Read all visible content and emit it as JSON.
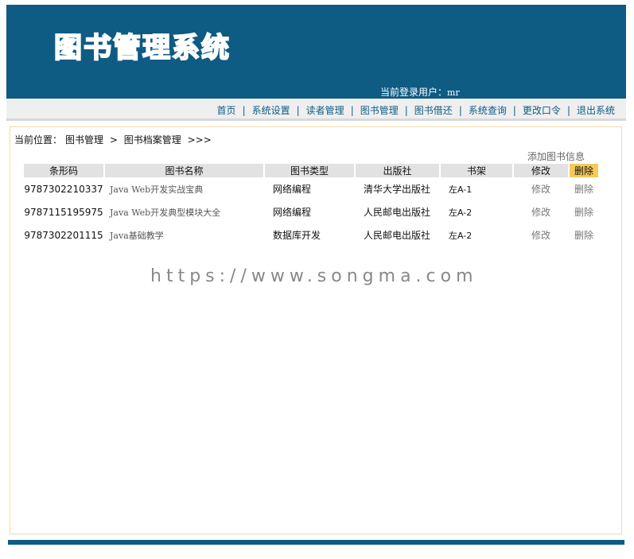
{
  "header": {
    "logo_text": "图书管理系统",
    "login_label": "当前登录用户：",
    "login_user": "mr"
  },
  "nav": {
    "items": [
      "首页",
      "系统设置",
      "读者管理",
      "图书管理",
      "图书借还",
      "系统查询",
      "更改口令",
      "退出系统"
    ],
    "separator": "|"
  },
  "breadcrumb": {
    "label": "当前位置：",
    "section": "图书管理",
    "arrow": ">",
    "page": "图书档案管理",
    "trail": ">>>"
  },
  "actions": {
    "add_book": "添加图书信息"
  },
  "table": {
    "columns": [
      "条形码",
      "图书名称",
      "图书类型",
      "出版社",
      "书架",
      "修改",
      "删除"
    ],
    "rows": [
      {
        "barcode": "9787302210337",
        "name": "Java Web开发实战宝典",
        "type": "网络编程",
        "publisher": "清华大学出版社",
        "shelf": "左A-1",
        "edit": "修改",
        "delete": "删除"
      },
      {
        "barcode": "9787115195975",
        "name": "Java Web开发典型模块大全",
        "type": "网络编程",
        "publisher": "人民邮电出版社",
        "shelf": "左A-2",
        "edit": "修改",
        "delete": "删除"
      },
      {
        "barcode": "9787302201115",
        "name": "Java基础教学",
        "type": "数据库开发",
        "publisher": "人民邮电出版社",
        "shelf": "左A-2",
        "edit": "修改",
        "delete": "删除"
      }
    ]
  },
  "watermark": "https://www.songma.com",
  "colors": {
    "brand": "#0e5b83",
    "highlight": "#f5c95a",
    "panel_border": "#f0dca6"
  }
}
